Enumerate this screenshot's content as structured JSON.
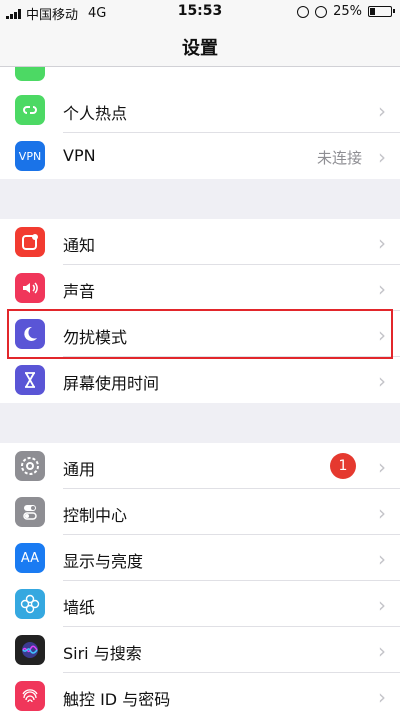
{
  "status": {
    "carrier": "中国移动",
    "network": "4G",
    "time": "15:53",
    "battery": "25%",
    "battery_level": 0.25
  },
  "nav": {
    "title": "设置"
  },
  "group1": [
    {
      "label": "个人热点",
      "icon": "hotspot-icon",
      "color": "#4cd964"
    },
    {
      "label": "VPN",
      "value": "未连接",
      "icon": "vpn-icon",
      "color": "#1a73e8",
      "icon_text": "VPN"
    }
  ],
  "group2": [
    {
      "label": "通知",
      "icon": "notifications-icon",
      "color": "#f23b30"
    },
    {
      "label": "声音",
      "icon": "sound-icon",
      "color": "#f0365a"
    },
    {
      "label": "勿扰模式",
      "icon": "moon-icon",
      "color": "#5a55d6"
    },
    {
      "label": "屏幕使用时间",
      "icon": "hourglass-icon",
      "color": "#5a55d6"
    }
  ],
  "group3": [
    {
      "label": "通用",
      "badge": "1",
      "icon": "gear-icon",
      "color": "#8e8e93"
    },
    {
      "label": "控制中心",
      "icon": "toggles-icon",
      "color": "#8e8e93"
    },
    {
      "label": "显示与亮度",
      "icon": "display-icon",
      "color": "#1a7bf2",
      "icon_text": "AA"
    },
    {
      "label": "墙纸",
      "icon": "wallpaper-icon",
      "color": "#35a8e0"
    },
    {
      "label": "Siri 与搜索",
      "icon": "siri-icon",
      "color": "#222"
    },
    {
      "label": "触控 ID 与密码",
      "icon": "fingerprint-icon",
      "color": "#f0365a"
    }
  ]
}
